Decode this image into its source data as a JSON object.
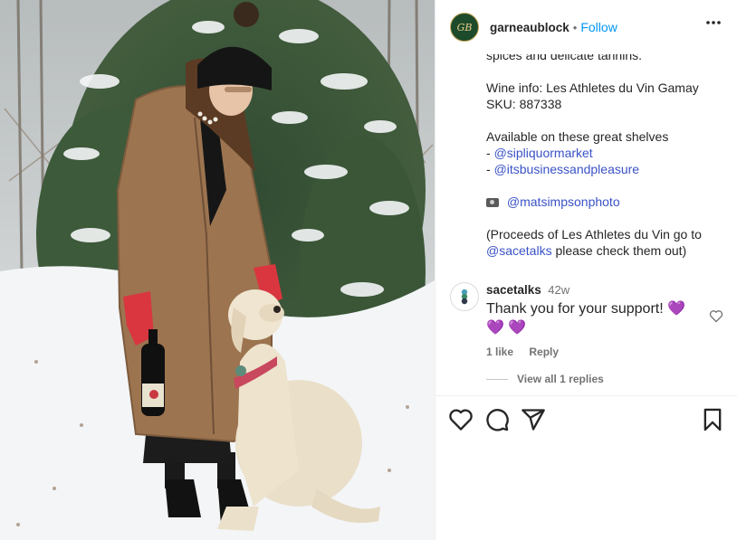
{
  "post": {
    "username": "garneaublock",
    "follow_label": "Follow",
    "separator": "•",
    "avatar_initials": "GB"
  },
  "caption": {
    "line1": "spices and delicate tannins.",
    "wine_info": "Wine info: Les Athletes du Vin Gamay",
    "sku": "SKU: 887338",
    "available": "Available on these great shelves",
    "dash": "- ",
    "mention1": "@sipliquormarket",
    "mention2": "@itsbusinessandpleasure",
    "photo_credit": "@matsimpsonphoto",
    "proceeds_line": "(Proceeds of Les Athletes du Vin go to",
    "proceeds_mention": "@sacetalks",
    "proceeds_end": " please check them out)"
  },
  "comment": {
    "user": "sacetalks",
    "time": "42w",
    "text": "Thank you for your support!",
    "emoji": "💜",
    "likes": "1 like",
    "reply": "Reply",
    "view_replies": "View all 1 replies"
  },
  "icons": [
    "more-icon",
    "camera-icon",
    "heart-icon",
    "comment-icon",
    "share-icon",
    "save-icon"
  ]
}
